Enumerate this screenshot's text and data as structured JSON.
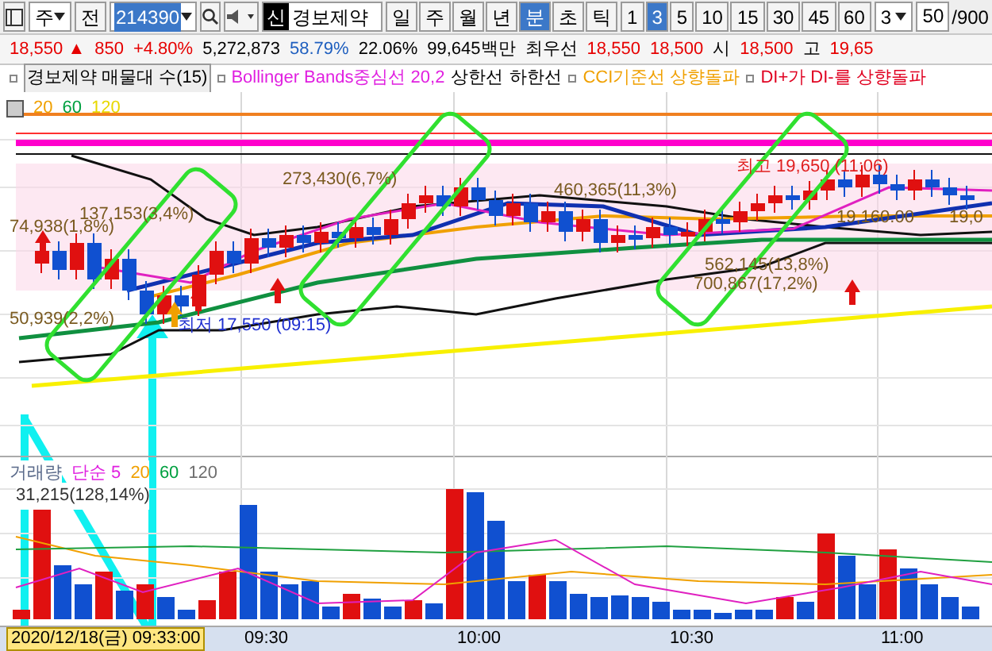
{
  "toolbar": {
    "market": "주",
    "prev_button": "전",
    "code": "214390",
    "badge": "신",
    "name": "경보제약",
    "periods": [
      {
        "label": "일",
        "selected": false
      },
      {
        "label": "주",
        "selected": false
      },
      {
        "label": "월",
        "selected": false
      },
      {
        "label": "년",
        "selected": false
      },
      {
        "label": "분",
        "selected": true
      },
      {
        "label": "초",
        "selected": false
      },
      {
        "label": "틱",
        "selected": false
      }
    ],
    "intervals": [
      {
        "label": "1",
        "selected": false
      },
      {
        "label": "3",
        "selected": true
      },
      {
        "label": "5",
        "selected": false
      },
      {
        "label": "10",
        "selected": false
      },
      {
        "label": "15",
        "selected": false
      },
      {
        "label": "30",
        "selected": false
      },
      {
        "label": "45",
        "selected": false
      },
      {
        "label": "60",
        "selected": false
      }
    ],
    "unit_select": "3",
    "count": "50",
    "count_max": "/900"
  },
  "quote": [
    {
      "text": "18,550 ▲",
      "color": "#e60000"
    },
    {
      "text": "850",
      "color": "#e60000"
    },
    {
      "text": "+4.80%",
      "color": "#e60000"
    },
    {
      "text": "5,272,873",
      "color": "#000000"
    },
    {
      "text": "58.79%",
      "color": "#1f5fbf"
    },
    {
      "text": "22.06%",
      "color": "#000000"
    },
    {
      "text": "99,645백만",
      "color": "#000000"
    },
    {
      "text": "최우선",
      "color": "#000000"
    },
    {
      "text": "18,550",
      "color": "#e60000"
    },
    {
      "text": "18,500",
      "color": "#e60000"
    },
    {
      "text": "시",
      "color": "#000000"
    },
    {
      "text": "18,500",
      "color": "#e60000"
    },
    {
      "text": "고",
      "color": "#000000"
    },
    {
      "text": "19,65",
      "color": "#e60000"
    }
  ],
  "legend": [
    {
      "text": "경보제약 매물대 수(15)",
      "color": "#000000"
    },
    {
      "text": "Bollinger Bands중심선 20,2",
      "color": "#e020e0"
    },
    {
      "text": "상한선",
      "color": "#000000"
    },
    {
      "text": "하한선",
      "color": "#000000"
    },
    {
      "text": "CCI기준선 상향돌파",
      "color": "#f0a000"
    },
    {
      "text": "DI+가 DI-를 상향돌파",
      "color": "#e00020"
    }
  ],
  "ma_legend": [
    {
      "text": "20",
      "color": "#f0a000"
    },
    {
      "text": "60",
      "color": "#00a040"
    },
    {
      "text": "120",
      "color": "#e8d800"
    }
  ],
  "price_labels": [
    "74,938(1,8%)",
    "137,153(3,4%)",
    "273,430(6,7%)",
    "50,939(2,2%)",
    "460,365(11,3%)",
    "562,145(13,8%)",
    "700,867(17,2%)",
    "19,160.00",
    "19,0"
  ],
  "high_label": "최고 19,650 (11:06)",
  "low_label": "최저 17,550 (09:15)",
  "volume": {
    "legend": [
      {
        "text": "거래량",
        "color": "#5a6a8a"
      },
      {
        "text": "단순 5",
        "color": "#e020e0"
      },
      {
        "text": "20",
        "color": "#f0a000"
      },
      {
        "text": "60",
        "color": "#00a040"
      },
      {
        "text": "120",
        "color": "#707070"
      }
    ],
    "reading": "31,215(128,14%)"
  },
  "time_axis": {
    "start": "2020/12/18(금) 09:33:00",
    "ticks": [
      "09:30",
      "10:00",
      "10:30",
      "11:00"
    ]
  }
}
